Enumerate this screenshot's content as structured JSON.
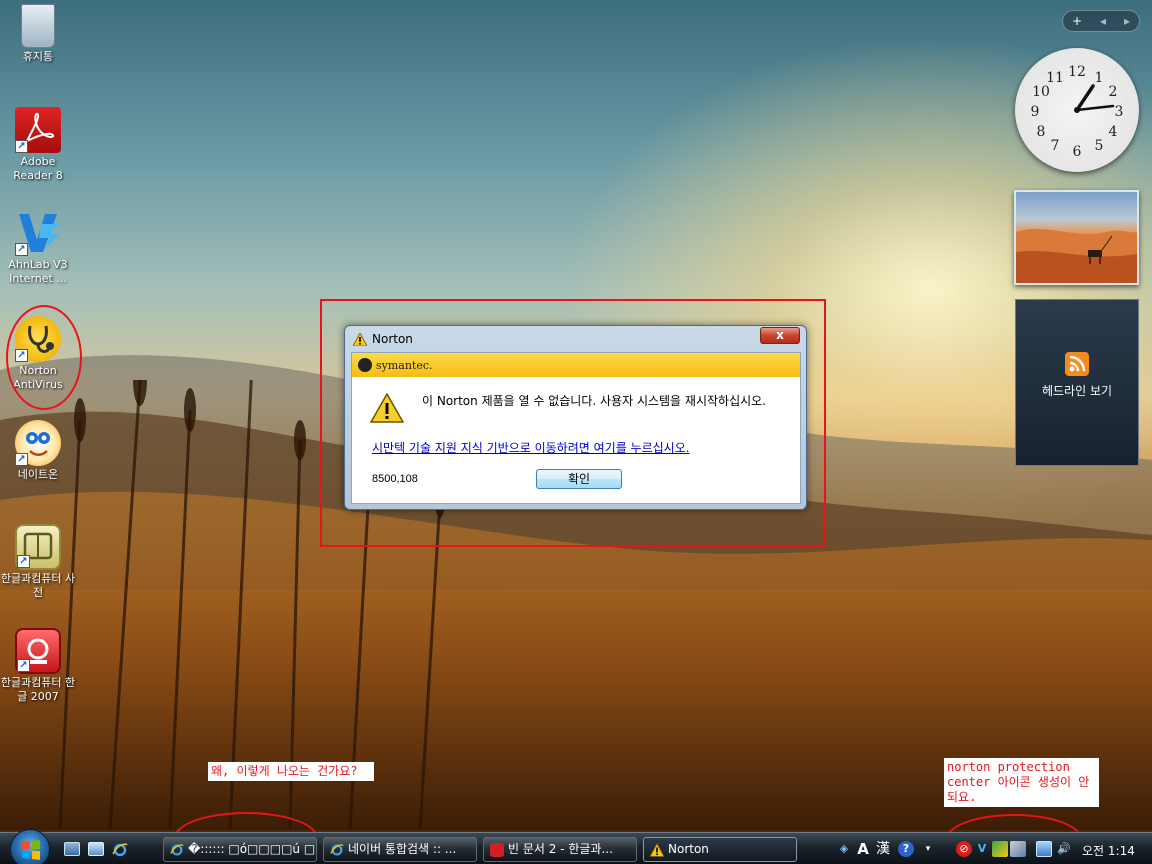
{
  "desktop": {
    "icons": [
      {
        "label": "휴지통"
      },
      {
        "label": "Adobe Reader 8"
      },
      {
        "label": "AhnLab V3 Internet ..."
      },
      {
        "label": "Norton AntiVirus"
      },
      {
        "label": "네이트온"
      },
      {
        "label": "한글과컴퓨터 사전"
      },
      {
        "label": "한글과컴퓨터 한글 2007"
      }
    ]
  },
  "gadgets": {
    "clock_numbers": [
      "12",
      "1",
      "2",
      "3",
      "4",
      "5",
      "6",
      "7",
      "8",
      "9",
      "10",
      "11"
    ],
    "feed_label": "헤드라인 보기"
  },
  "dialog": {
    "title": "Norton",
    "close_label": "x",
    "brand": "symantec.",
    "message": "이 Norton 제품을 열 수 없습니다. 사용자 시스템을 재시작하십시오.",
    "link": "시만텍 기술 지원 지식 기반으로 이동하려면 여기를 누르십시오.",
    "error_code": "8500,108",
    "ok_label": "확인"
  },
  "annotations": {
    "left_note": "왜, 이렇게 나오는 건가요?",
    "right_note": "norton protection center 아이콘 생성이 안되요."
  },
  "taskbar": {
    "tasks": [
      {
        "label": "�:::::: □ó□□□□ú □..."
      },
      {
        "label": "네이버 통합검색 :: ..."
      },
      {
        "label": "빈 문서 2 - 한글과..."
      },
      {
        "label": "Norton"
      }
    ],
    "tray_lang": "A",
    "tray_hanja": "漢",
    "clock": "오전 1:14"
  },
  "colors": {
    "annotation_red": "#e8141b",
    "symantec_yellow": "#f4bd12",
    "link_blue": "#0000cc"
  }
}
